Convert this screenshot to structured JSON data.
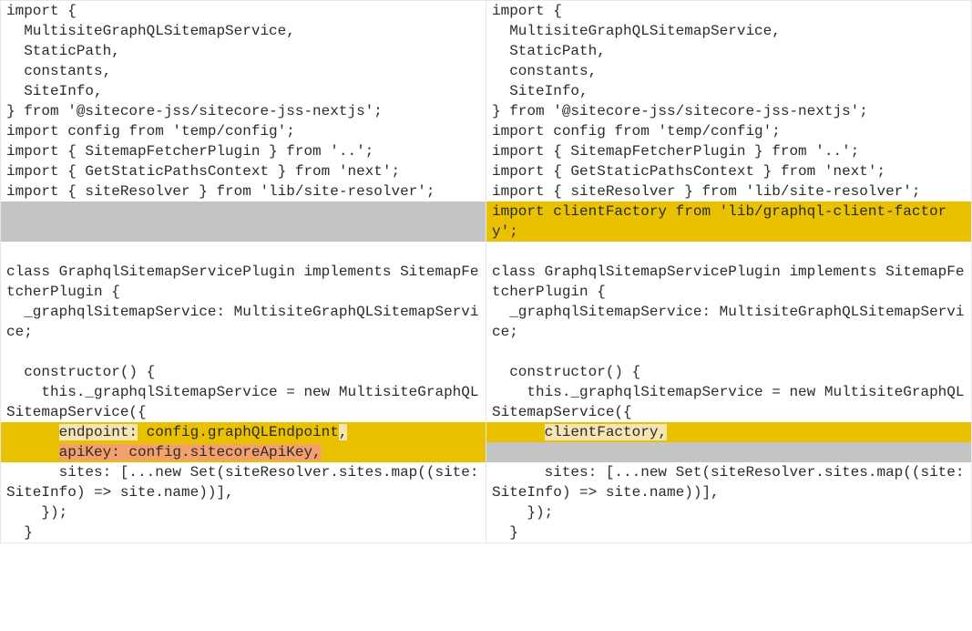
{
  "diff": {
    "left": {
      "lines": [
        {
          "id": "l1",
          "class": "",
          "text": "import {"
        },
        {
          "id": "l2",
          "class": "",
          "text": "  MultisiteGraphQLSitemapService,"
        },
        {
          "id": "l3",
          "class": "",
          "text": "  StaticPath,"
        },
        {
          "id": "l4",
          "class": "",
          "text": "  constants,"
        },
        {
          "id": "l5",
          "class": "",
          "text": "  SiteInfo,"
        },
        {
          "id": "l6",
          "class": "",
          "text": "} from '@sitecore-jss/sitecore-jss-nextjs';"
        },
        {
          "id": "l7",
          "class": "",
          "text": "import config from 'temp/config';"
        },
        {
          "id": "l8",
          "class": "",
          "text": "import { SitemapFetcherPlugin } from '..';"
        },
        {
          "id": "l9",
          "class": "",
          "text": "import { GetStaticPathsContext } from 'next';"
        },
        {
          "id": "l10",
          "class": "",
          "text": "import { siteResolver } from 'lib/site-resolver';"
        },
        {
          "id": "l11",
          "class": "hl-missing full",
          "text": " "
        },
        {
          "id": "l11b",
          "class": "hl-missing full",
          "text": " "
        },
        {
          "id": "l12",
          "class": "",
          "text": ""
        },
        {
          "id": "l13",
          "class": "",
          "text": "class GraphqlSitemapServicePlugin implements SitemapFetcherPlugin {"
        },
        {
          "id": "l14",
          "class": "",
          "text": "  _graphqlSitemapService: MultisiteGraphQLSitemapService;"
        },
        {
          "id": "l15",
          "class": "",
          "text": ""
        },
        {
          "id": "l16",
          "class": "",
          "text": "  constructor() {"
        },
        {
          "id": "l17",
          "class": "",
          "text": "    this._graphqlSitemapService = new MultisiteGraphQLSitemapService({"
        },
        {
          "id": "l20",
          "class": "",
          "text": "      sites: [...new Set(siteResolver.sites.map((site: SiteInfo) => site.name))],"
        },
        {
          "id": "l21",
          "class": "",
          "text": "    });"
        },
        {
          "id": "l22",
          "class": "",
          "text": "  }"
        }
      ],
      "mixed": {
        "m1": {
          "indent": "      ",
          "seg1": "endpoint:",
          "seg2": " config.graphQLEndpoint",
          "seg3": ","
        },
        "m2": {
          "indent": "      ",
          "seg1": "apiKey: config.sitecoreApiKey,"
        }
      }
    },
    "right": {
      "lines": [
        {
          "id": "r1",
          "class": "",
          "text": "import {"
        },
        {
          "id": "r2",
          "class": "",
          "text": "  MultisiteGraphQLSitemapService,"
        },
        {
          "id": "r3",
          "class": "",
          "text": "  StaticPath,"
        },
        {
          "id": "r4",
          "class": "",
          "text": "  constants,"
        },
        {
          "id": "r5",
          "class": "",
          "text": "  SiteInfo,"
        },
        {
          "id": "r6",
          "class": "",
          "text": "} from '@sitecore-jss/sitecore-jss-nextjs';"
        },
        {
          "id": "r7",
          "class": "",
          "text": "import config from 'temp/config';"
        },
        {
          "id": "r8",
          "class": "",
          "text": "import { SitemapFetcherPlugin } from '..';"
        },
        {
          "id": "r9",
          "class": "",
          "text": "import { GetStaticPathsContext } from 'next';"
        },
        {
          "id": "r10",
          "class": "",
          "text": "import { siteResolver } from 'lib/site-resolver';"
        },
        {
          "id": "r11",
          "class": "hl-add-line full",
          "text": "import clientFactory from 'lib/graphql-client-factory';"
        },
        {
          "id": "r12",
          "class": "",
          "text": ""
        },
        {
          "id": "r13",
          "class": "",
          "text": "class GraphqlSitemapServicePlugin implements SitemapFetcherPlugin {"
        },
        {
          "id": "r14",
          "class": "",
          "text": "  _graphqlSitemapService: MultisiteGraphQLSitemapService;"
        },
        {
          "id": "r15",
          "class": "",
          "text": ""
        },
        {
          "id": "r16",
          "class": "",
          "text": "  constructor() {"
        },
        {
          "id": "r17",
          "class": "",
          "text": "    this._graphqlSitemapService = new MultisiteGraphQLSitemapService({"
        },
        {
          "id": "r19",
          "class": "hl-missing full",
          "text": " "
        },
        {
          "id": "r20",
          "class": "",
          "text": "      sites: [...new Set(siteResolver.sites.map((site: SiteInfo) => site.name))],"
        },
        {
          "id": "r21",
          "class": "",
          "text": "    });"
        },
        {
          "id": "r22",
          "class": "",
          "text": "  }"
        }
      ],
      "mixed": {
        "m1": {
          "indent": "      ",
          "seg1": "clientFactory",
          "seg2": ","
        }
      }
    }
  }
}
